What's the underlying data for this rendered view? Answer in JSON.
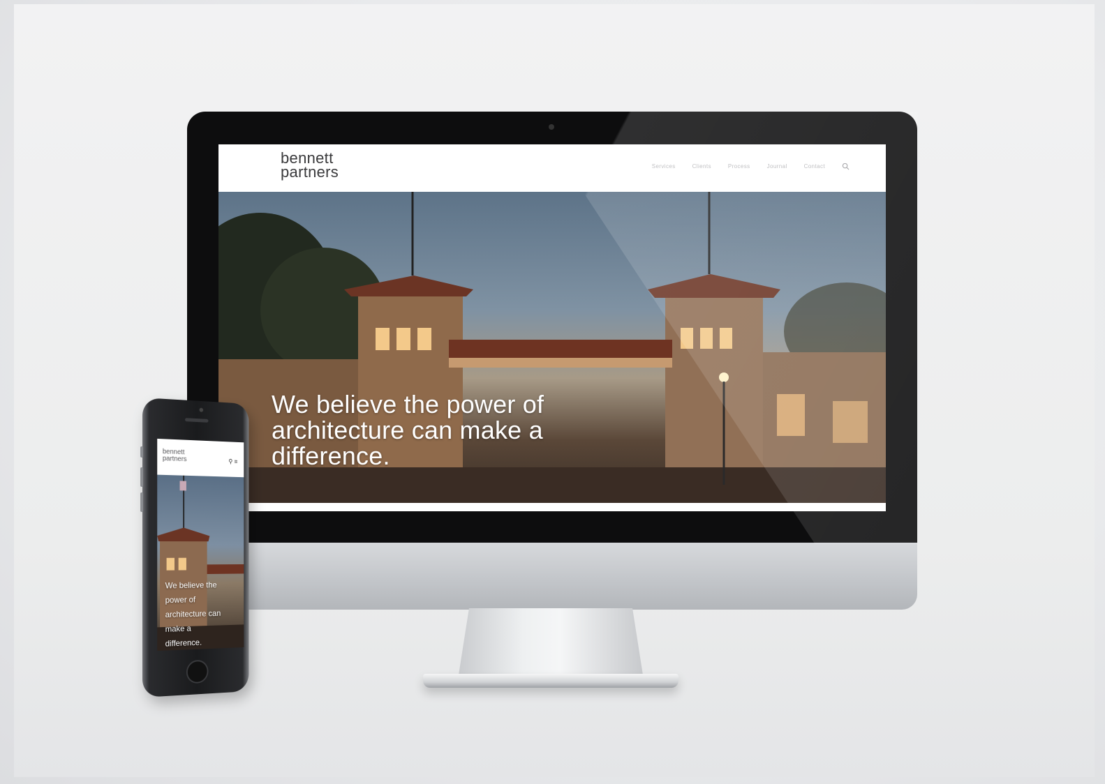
{
  "desktop_site": {
    "logo": {
      "line1": "bennett",
      "line2": "partners"
    },
    "nav": {
      "items": [
        "Services",
        "Clients",
        "Process",
        "Journal",
        "Contact"
      ]
    },
    "hero": {
      "headline_lines": [
        "We believe the power of",
        "architecture can make a",
        "difference."
      ]
    }
  },
  "mobile_site": {
    "logo": {
      "line1": "bennett",
      "line2": "partners"
    },
    "icons": "⚲ ≡",
    "hero": {
      "headline_lines": [
        "We believe the",
        "power of",
        "architecture can",
        "make a",
        "difference."
      ]
    }
  },
  "colors": {
    "accent_text": "#ffffff",
    "logo_text": "#3a3a3c",
    "nav_text": "#b6b6b9"
  }
}
